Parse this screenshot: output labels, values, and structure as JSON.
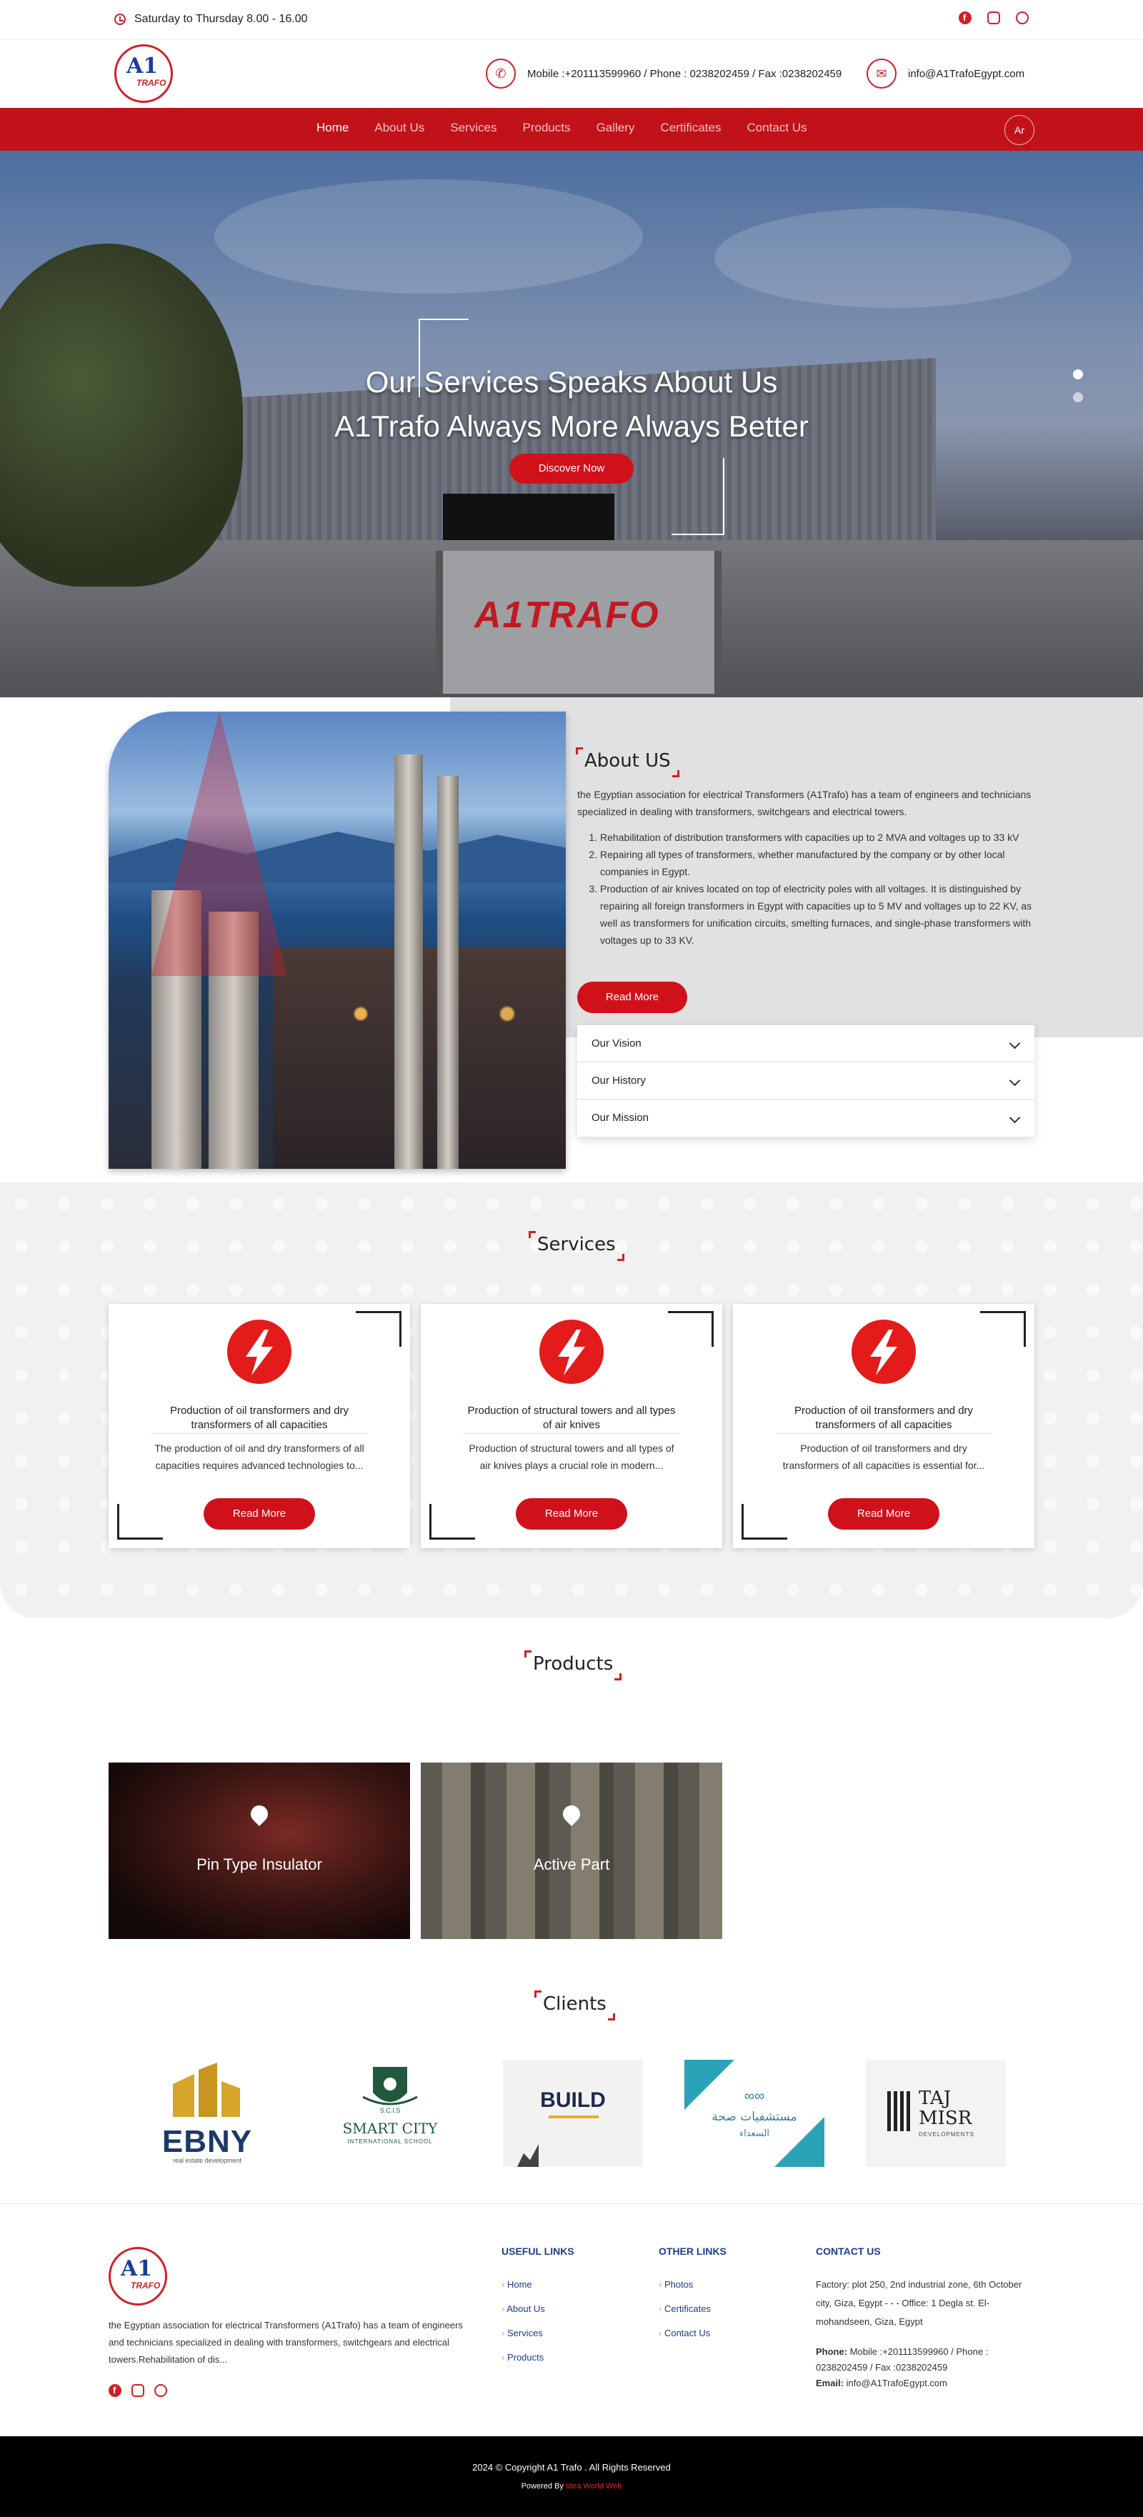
{
  "topbar": {
    "hours": "Saturday to Thursday 8.00 - 16.00",
    "social": [
      "facebook-icon",
      "instagram-icon",
      "whatsapp-icon"
    ]
  },
  "header": {
    "logo_text": "A1",
    "logo_sub": "TRAFO",
    "phone": "Mobile :+201113599960 / Phone : 0238202459 / Fax :0238202459",
    "email": "info@A1TrafoEgypt.com"
  },
  "nav": {
    "items": [
      "Home",
      "About Us",
      "Services",
      "Products",
      "Gallery",
      "Certificates",
      "Contact Us"
    ],
    "lang": "Ar"
  },
  "hero": {
    "line1": "Our Services Speaks About Us",
    "line2": "A1Trafo Always More Always Better",
    "button": "Discover Now",
    "gate_name": "A1TRAFO"
  },
  "about": {
    "title": "About US",
    "intro": "the Egyptian association for electrical Transformers (A1Trafo) has a team of engineers and technicians specialized in dealing with transformers, switchgears and electrical towers.",
    "points": [
      "Rehabilitation of distribution transformers with capacities up to 2 MVA and voltages up to 33 kV",
      "Repairing all types of transformers, whether manufactured by the company or by other local companies in Egypt.",
      "Production of air knives located on top of electricity poles with all voltages. It is distinguished by repairing all foreign transformers in Egypt with capacities up to 5 MV and voltages up to 22 KV, as well as transformers for unification circuits, smelting furnaces, and single-phase transformers with voltages up to 33 KV."
    ],
    "button": "Read More",
    "accordion": [
      "Our Vision",
      "Our History",
      "Our Mission"
    ]
  },
  "services": {
    "title": "Services",
    "cards": [
      {
        "title": "Production of oil transformers and dry transformers of all capacities",
        "desc": "The production of oil and dry transformers of all capacities requires advanced technologies to...",
        "button": "Read More"
      },
      {
        "title": "Production of structural towers and all types of air knives",
        "desc": "Production of structural towers and all types of air knives plays a crucial role in modern...",
        "button": "Read More"
      },
      {
        "title": "Production of oil transformers and dry transformers of all capacities",
        "desc": "Production of oil transformers and dry transformers of all capacities is essential for...",
        "button": "Read More"
      }
    ]
  },
  "products": {
    "title": "Products",
    "items": [
      "Pin Type Insulator",
      "Active Part"
    ]
  },
  "clients": {
    "title": "Clients",
    "logos": [
      {
        "main": "EBNY",
        "sub": "real estate development"
      },
      {
        "main": "SMART CITY",
        "sub": "INTERNATIONAL SCHOOL",
        "top": "S.C.I.S"
      },
      {
        "main": "BUILD",
        "sub": ""
      },
      {
        "main": "مستشفيات صحة",
        "sub": "السعداء"
      },
      {
        "main": "TAJ MISR",
        "sub": "DEVELOPMENTS"
      }
    ]
  },
  "footer": {
    "about": "the Egyptian association for electrical Transformers (A1Trafo) has a team of engineers and technicians specialized in dealing with transformers, switchgears and electrical towers.Rehabilitation of dis...",
    "useful_title": "USEFUL LINKS",
    "useful": [
      "Home",
      "About Us",
      "Services",
      "Products"
    ],
    "other_title": "OTHER LINKS",
    "other": [
      "Photos",
      "Certificates",
      "Contact Us"
    ],
    "contact_title": "CONTACT US",
    "address": "Factory: plot 250, 2nd industrial zone, 6th October city, Giza, Egypt - - - Office: 1 Degla st. El-mohandseen, Giza, Egypt",
    "phone_label": "Phone:",
    "phone": "Mobile :+201113599960 / Phone : 0238202459 / Fax :0238202459",
    "email_label": "Email:",
    "email": "info@A1TrafoEgypt.com"
  },
  "bottom": {
    "copyright": "2024 © Copyright A1 Trafo . All Rights Reserved",
    "powered_label": "Powered By",
    "powered_by": "Idea World Web"
  },
  "colors": {
    "brand_red": "#c1121a",
    "navy": "#1c3d8d"
  }
}
